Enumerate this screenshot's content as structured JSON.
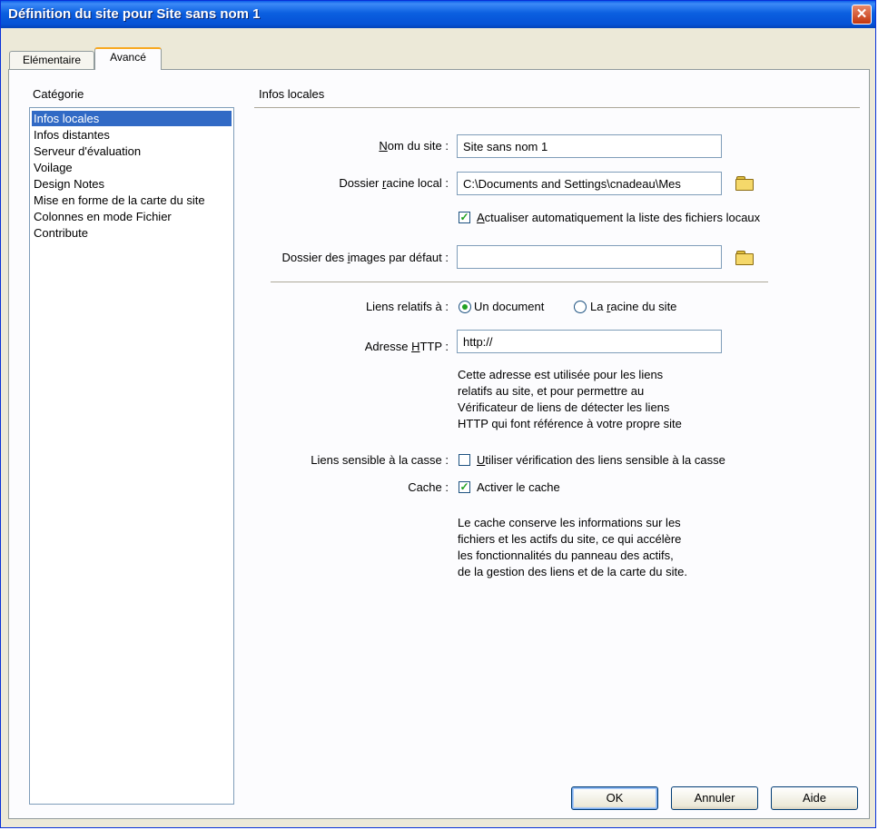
{
  "window": {
    "title": "Définition du site pour Site sans nom 1",
    "close_glyph": "✕"
  },
  "tabs": [
    {
      "label": "Elémentaire"
    },
    {
      "label": "Avancé"
    }
  ],
  "category": {
    "label": "Catégorie",
    "items": [
      {
        "label": "Infos locales"
      },
      {
        "label": "Infos distantes"
      },
      {
        "label": "Serveur d'évaluation"
      },
      {
        "label": "Voilage"
      },
      {
        "label": "Design Notes"
      },
      {
        "label": "Mise en forme de la carte du site"
      },
      {
        "label": "Colonnes en mode Fichier"
      },
      {
        "label": "Contribute"
      }
    ],
    "selected": "Infos locales"
  },
  "section": {
    "title": "Infos locales"
  },
  "form": {
    "site_name": {
      "label_pre": "",
      "label_key": "N",
      "label_post": "om du site :",
      "value": "Site sans nom 1"
    },
    "local_root": {
      "label_pre": "Dossier ",
      "label_key": "r",
      "label_post": "acine local :",
      "value": "C:\\Documents and Settings\\cnadeau\\Mes"
    },
    "auto_refresh": {
      "key": "A",
      "label": "ctualiser automatiquement la liste des fichiers locaux",
      "checked": true
    },
    "default_images": {
      "label_pre": "Dossier des ",
      "label_key": "i",
      "label_post": "mages par défaut :",
      "value": ""
    },
    "relative_links": {
      "label": "Liens relatifs à :",
      "option_document": "Un document",
      "option_root_pre": "La ",
      "option_root_key": "r",
      "option_root_post": "acine du site",
      "selected": "Un document"
    },
    "http_address": {
      "label_pre": "Adresse ",
      "label_key": "H",
      "label_post": "TTP :",
      "value": "http://"
    },
    "http_note": [
      "Cette adresse est utilisée pour les liens",
      "relatifs au site, et pour permettre au",
      "Vérificateur de liens de détecter les liens",
      "HTTP qui font référence à votre propre site"
    ],
    "case_sensitive": {
      "label": "Liens sensible à la casse :",
      "key": "U",
      "checkbox_label": "tiliser vérification des liens sensible à la casse",
      "checked": false
    },
    "cache": {
      "label": "Cache :",
      "checkbox_label": "Activer le cache",
      "checked": true
    },
    "cache_note": [
      "Le cache conserve les informations sur les",
      "fichiers et les actifs du site, ce qui accélère",
      "les fonctionnalités du panneau des actifs,",
      "de la gestion des liens et de la carte du site."
    ]
  },
  "buttons": {
    "ok": "OK",
    "cancel": "Annuler",
    "help": "Aide"
  },
  "icons": {
    "folder": "folder-icon",
    "checkmark": "✓"
  }
}
